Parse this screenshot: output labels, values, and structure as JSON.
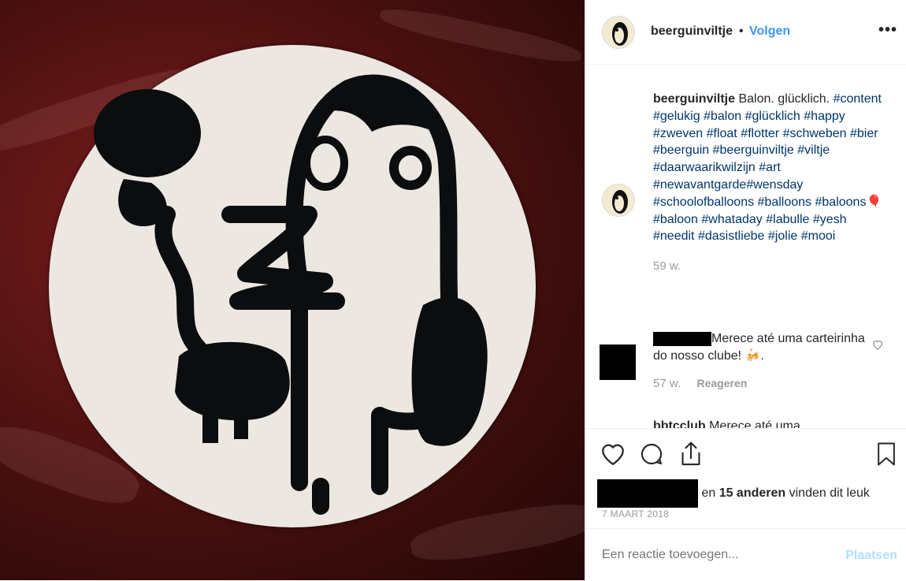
{
  "post": {
    "username": "beerguinviltje",
    "separator": "•",
    "follow_label": "Volgen",
    "more_label": "•••",
    "caption_text": "Balon. glücklich.",
    "hashtags": [
      "#content",
      "#gelukig",
      "#balon",
      "#glücklich",
      "#happy",
      "#zweven",
      "#float",
      "#flotter",
      "#schweben",
      "#bier",
      "#beerguin",
      "#beerguinviltje",
      "#viltje",
      "#daarwaarikwilzijn",
      "#art",
      "#newavantgarde#wensday",
      "#schoolofballoons",
      "#balloons",
      "#baloons🎈",
      "#baloon",
      "#whataday",
      "#labulle",
      "#yesh",
      "#needit",
      "#dasistliebe",
      "#jolie",
      "#mooi"
    ],
    "caption_age": "59 w."
  },
  "comments": [
    {
      "text": "Merece até uma carteirinha do nosso clube! 🍻.",
      "age": "57 w.",
      "reply_label": "Reageren"
    },
    {
      "username": "bbtcclub",
      "text": "Merece até uma"
    }
  ],
  "likes": {
    "middle": " en ",
    "count_label": "15 anderen",
    "suffix": " vinden dit leuk"
  },
  "date": "7 MAART 2018",
  "add_comment": {
    "placeholder": "Een reactie toevoegen...",
    "post_label": "Plaatsen"
  },
  "colors": {
    "link": "#3897f0",
    "hashtag": "#003569",
    "muted": "#999999",
    "post_disabled": "#b2dffc"
  }
}
